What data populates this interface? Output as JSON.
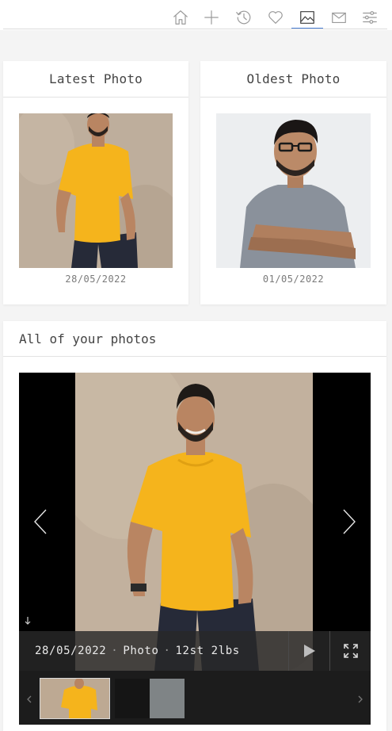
{
  "nav": {
    "items": [
      {
        "icon": "home-icon",
        "label": "home"
      },
      {
        "icon": "plus-icon",
        "label": "add"
      },
      {
        "icon": "history-icon",
        "label": "history"
      },
      {
        "icon": "heart-icon",
        "label": "favourites"
      },
      {
        "icon": "image-icon",
        "label": "photos",
        "active": true
      },
      {
        "icon": "mail-icon",
        "label": "messages"
      },
      {
        "icon": "sliders-icon",
        "label": "settings"
      }
    ],
    "accent": "#4a7fd6"
  },
  "latest": {
    "title": "Latest Photo",
    "date": "28/05/2022"
  },
  "oldest": {
    "title": "Oldest Photo",
    "date": "01/05/2022"
  },
  "all_photos": {
    "title": "All of your photos",
    "current": {
      "date": "28/05/2022",
      "type": "Photo",
      "weight": "12st 2lbs"
    },
    "thumbnails": 2
  }
}
